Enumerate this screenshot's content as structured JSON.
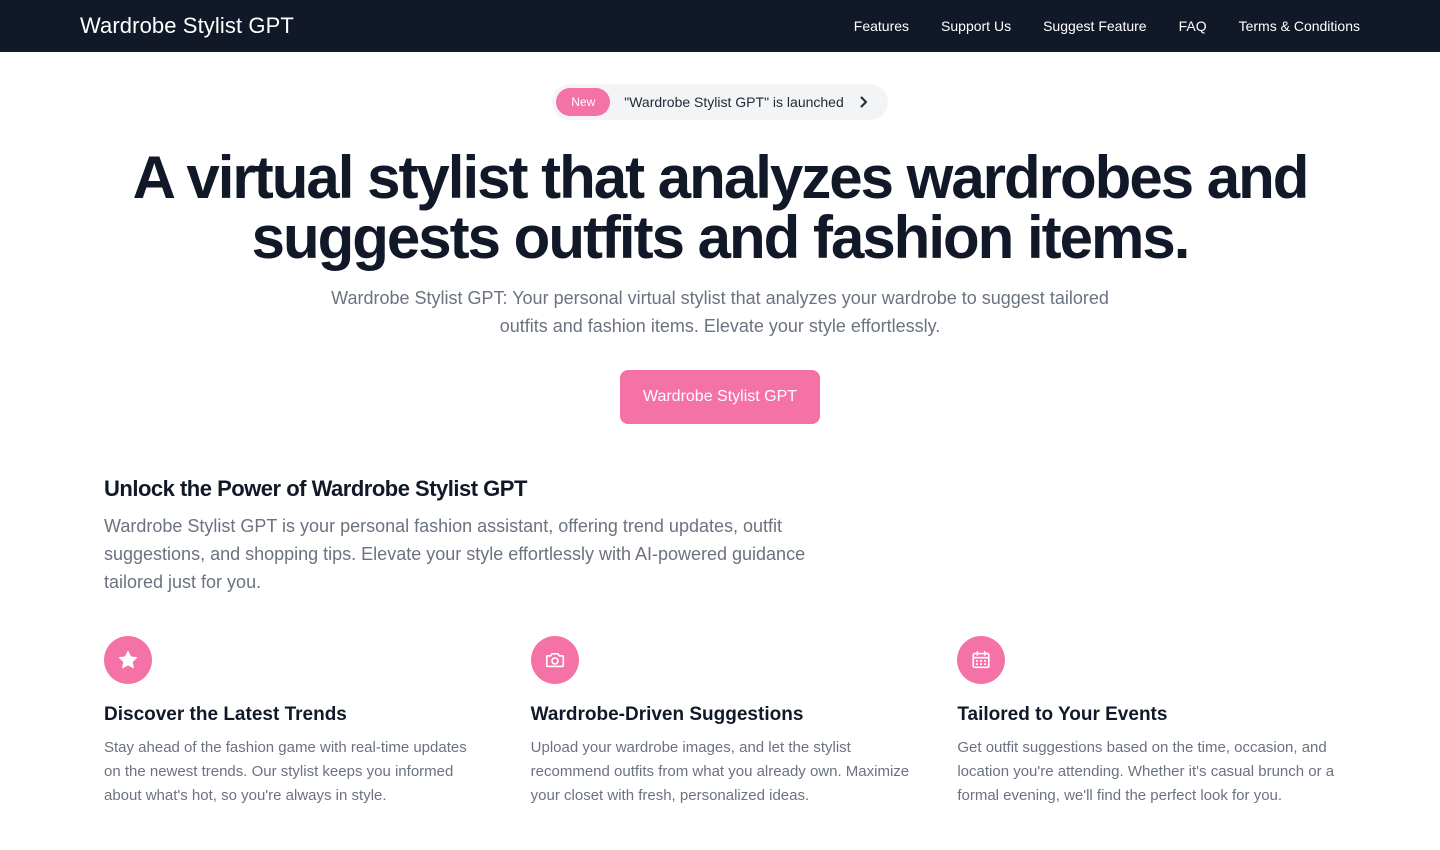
{
  "nav": {
    "brand": "Wardrobe Stylist GPT",
    "links": [
      "Features",
      "Support Us",
      "Suggest Feature",
      "FAQ",
      "Terms & Conditions"
    ]
  },
  "hero": {
    "badge": "New",
    "announcement": "\"Wardrobe Stylist GPT\" is launched",
    "title": "A virtual stylist that analyzes wardrobes and suggests outfits and fashion items.",
    "subtitle": "Wardrobe Stylist GPT: Your personal virtual stylist that analyzes your wardrobe to suggest tailored outfits and fashion items. Elevate your style effortlessly.",
    "cta_label": "Wardrobe Stylist GPT"
  },
  "about": {
    "title": "Unlock the Power of Wardrobe Stylist GPT",
    "description": "Wardrobe Stylist GPT is your personal fashion assistant, offering trend updates, outfit suggestions, and shopping tips. Elevate your style effortlessly with AI-powered guidance tailored just for you."
  },
  "features": [
    {
      "icon": "star-icon",
      "title": "Discover the Latest Trends",
      "description": "Stay ahead of the fashion game with real-time updates on the newest trends. Our stylist keeps you informed about what's hot, so you're always in style."
    },
    {
      "icon": "camera-icon",
      "title": "Wardrobe-Driven Suggestions",
      "description": "Upload your wardrobe images, and let the stylist recommend outfits from what you already own. Maximize your closet with fresh, personalized ideas."
    },
    {
      "icon": "calendar-icon",
      "title": "Tailored to Your Events",
      "description": "Get outfit suggestions based on the time, occasion, and location you're attending. Whether it's casual brunch or a formal evening, we'll find the perfect look for you."
    }
  ],
  "colors": {
    "navbar_bg": "#111827",
    "accent": "#f472a6",
    "heading": "#111827",
    "muted_text": "#6b7280"
  }
}
